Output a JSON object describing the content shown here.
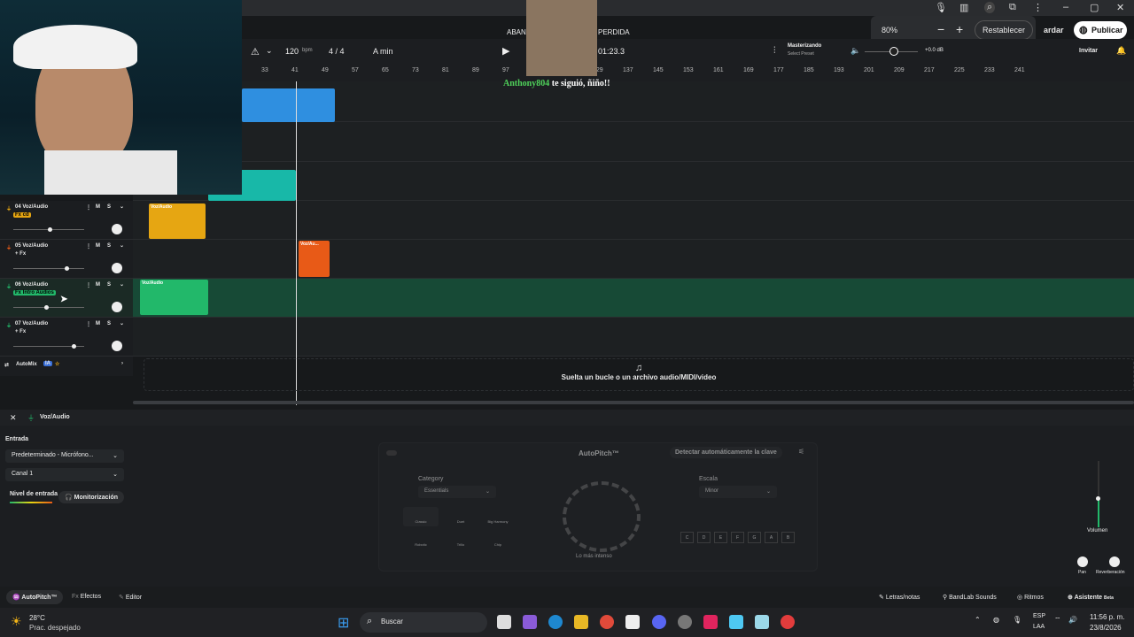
{
  "topbar": {
    "zoom": "80%",
    "reset_label": "Restablecer",
    "save_label": "ardar",
    "publish_label": "Publicar"
  },
  "transport": {
    "bpm": "120",
    "bpm_unit": "bpm",
    "time_sig": "4 / 4",
    "key": "A min",
    "song_title_left": "ABAN",
    "song_title_right": "PERDIDA",
    "time": "01:23.3",
    "mastering_label": "Masterizando",
    "mastering_preset": "Select Preset",
    "volume_db": "+0.0 dB",
    "invite_label": "Invitar"
  },
  "ruler": [
    "33",
    "41",
    "49",
    "57",
    "65",
    "73",
    "81",
    "89",
    "97",
    "113",
    "121",
    "129",
    "137",
    "145",
    "153",
    "161",
    "169",
    "177",
    "185",
    "193",
    "201",
    "209",
    "217",
    "225",
    "233",
    "241"
  ],
  "follow_alert": {
    "user": "Anthony804",
    "text": "te siguió, ñiño!!"
  },
  "tracks": [
    {
      "name": "04 Voz/Audio",
      "fx": "Fx cd",
      "clip_label": "Voz/Audio",
      "volume": 0.55
    },
    {
      "name": "05 Voz/Audio",
      "fx": "+ Fx",
      "clip_label": "Voz/Au...",
      "volume": 0.75
    },
    {
      "name": "06 Voz/Audio",
      "fx": "Fx Intro Audios",
      "clip_label": "Voz/Audio",
      "volume": 0.5
    },
    {
      "name": "07 Voz/Audio",
      "fx": "+ Fx",
      "clip_label": "",
      "volume": 0.85
    }
  ],
  "mute_label": "M",
  "solo_label": "S",
  "automix": {
    "label": "AutoMix",
    "badge": "IA"
  },
  "dropzone_text": "Suelta un bucle o un archivo audio/MIDI/video",
  "panel": {
    "track_title": "Voz/Audio",
    "input_label": "Entrada",
    "input_device": "Predeterminado - Micrófono...",
    "channel": "Canal 1",
    "level_label": "Nivel de entrada",
    "monitor_label": "Monitorización",
    "volume_label": "Volumen",
    "pan_label": "Pan",
    "reverb_label": "Reverberación"
  },
  "autopitch": {
    "title": "AutoPitch™",
    "detect_label": "Detectar automáticamente la clave",
    "category_label": "Category",
    "category_value": "Essentials",
    "scale_label": "Escala",
    "scale_value": "Minor",
    "presets": [
      "Classic",
      "Duet",
      "Big Harmony",
      "Robotic",
      "Trillo",
      "Chip"
    ],
    "knob_caption": "Lo más intenso",
    "notes_top": [
      "C#\nDb",
      "D#\nEb",
      "F#\nGb",
      "G#\nAb",
      "A#\nBb"
    ],
    "notes_bottom": [
      "C",
      "D",
      "E",
      "F",
      "G",
      "A",
      "B"
    ]
  },
  "footer": {
    "autopitch": "AutoPitch™",
    "effects": "Efectos",
    "editor": "Editor",
    "lyrics": "Letras/notas",
    "sounds": "BandLab Sounds",
    "rhythms": "Ritmos",
    "assistant": "Asistente",
    "beta": "Beta"
  },
  "taskbar": {
    "temp": "28°C",
    "weather": "Prac. despejado",
    "search": "Buscar",
    "lang": "ESP",
    "lang2": "LAA",
    "time": "11:56 p. m.",
    "date": "23/8/2026"
  }
}
